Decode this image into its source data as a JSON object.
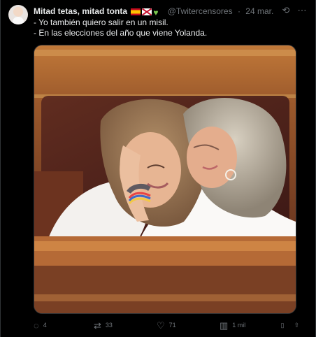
{
  "tweet": {
    "author": {
      "display_name": "Mitad tetas, mitad tonta",
      "handle": "@Twitercensores",
      "date": "24 mar."
    },
    "lines": [
      "- Yo también quiero salir en un misil.",
      "- En las elecciones del año que viene Yolanda."
    ],
    "stats": {
      "replies": "4",
      "retweets": "33",
      "likes": "71",
      "views": "1 mil"
    },
    "icons": {
      "grok": "grok-icon",
      "more": "more-icon",
      "reply": "reply-icon",
      "retweet": "retweet-icon",
      "like": "heart-icon",
      "views": "views-icon",
      "bookmark": "bookmark-icon",
      "share": "share-icon"
    },
    "colors": {
      "background": "#000000",
      "text": "#e7e9ea",
      "secondary": "#71767b",
      "border": "#2f3336"
    }
  }
}
